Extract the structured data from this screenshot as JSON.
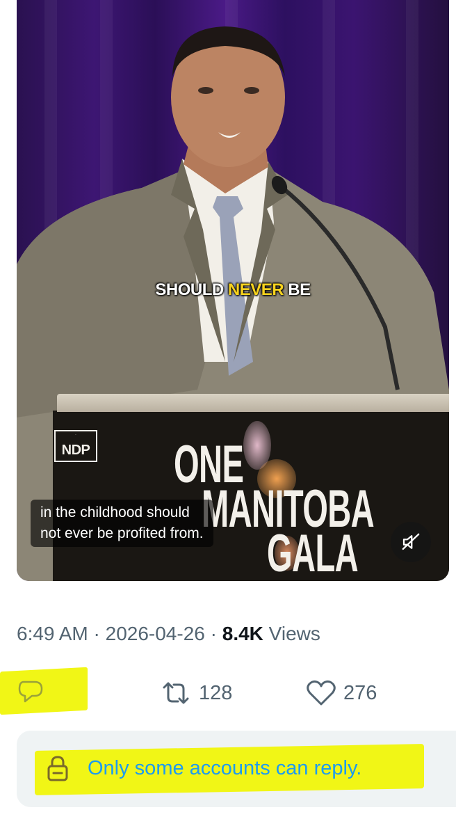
{
  "video": {
    "caption_overlay": {
      "part1": "SHOULD ",
      "part2": "NEVER",
      "part3": " BE"
    },
    "podium": {
      "logo_text": "NDP",
      "title_line1": "ONE",
      "title_line2": "MANITOBA",
      "title_line3": "GALA"
    },
    "subtitle": "in the childhood should\nnot ever be profited from.",
    "mute_icon": "speaker-muted-icon"
  },
  "post_meta": {
    "time": "6:49 AM",
    "separator": " · ",
    "date": "2026-04-26",
    "views_count": "8.4K",
    "views_label": " Views"
  },
  "actions": {
    "reply_icon": "reply-bubble-icon",
    "reply_count": "",
    "retweet_icon": "retweet-icon",
    "retweet_count": "128",
    "like_icon": "heart-icon",
    "like_count": "276"
  },
  "reply_restriction": {
    "icon": "lock-icon",
    "text": "Only some accounts can reply."
  },
  "colors": {
    "accent_blue": "#1d9bf0",
    "muted_gray": "#536471",
    "highlight_yellow": "#f1f616",
    "caption_yellow": "#f7d21e"
  }
}
